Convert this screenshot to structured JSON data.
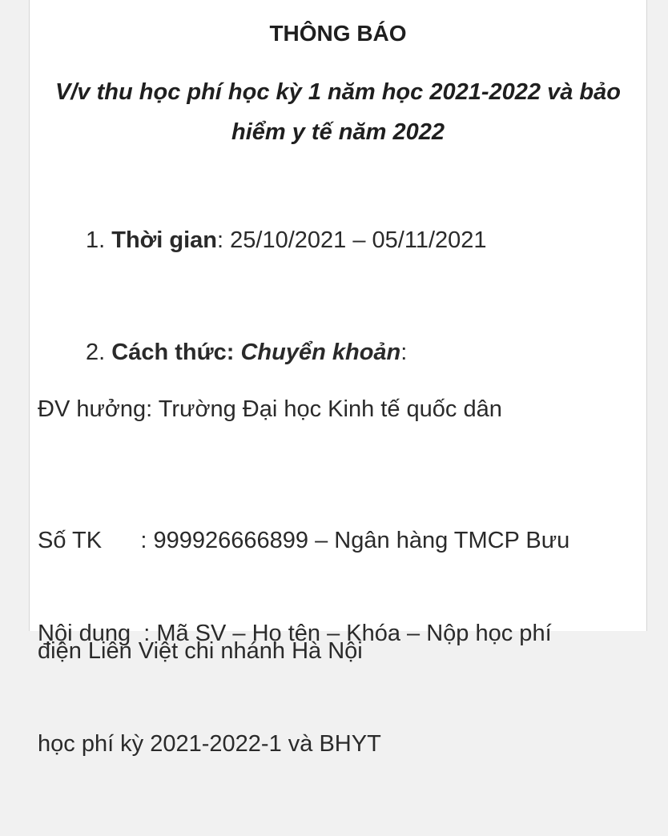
{
  "document": {
    "title": "THÔNG BÁO",
    "subtitle_line1": "V/v thu học phí học kỳ 1 năm học 2021-2022 và bảo",
    "subtitle_line2": "hiểm y tế năm 2022",
    "item1": {
      "number": "1.",
      "label": "Thời gian",
      "value": ": 25/10/2021 – 05/11/2021"
    },
    "item2": {
      "number": "2.",
      "label": "Cách thức:",
      "method": "Chuyển khoản",
      "suffix": ":"
    },
    "beneficiary": "ĐV hưởng: Trường Đại học Kinh tế quốc dân",
    "account_line1": "Số TK      : 999926666899 – Ngân hàng TMCP Bưu",
    "account_line2": "điện Liên Việt chi nhánh Hà Nội",
    "content_line1": "Nội dung  : Mã SV – Họ tên – Khóa – Nộp học phí",
    "content_line2": "học phí kỳ 2021-2022-1 và BHYT"
  }
}
